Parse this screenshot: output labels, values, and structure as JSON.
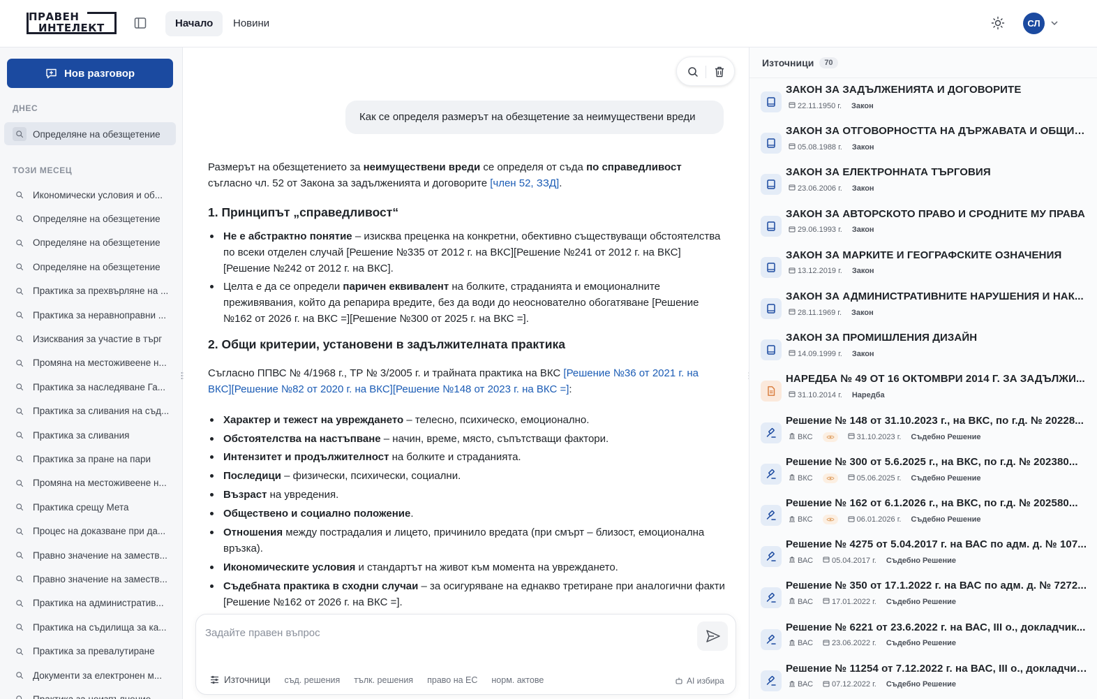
{
  "header": {
    "logo_line1": "ПРАВЕН",
    "logo_line2": "ИНТЕЛЕКТ",
    "tabs": [
      {
        "label": "Начало",
        "active": true
      },
      {
        "label": "Новини",
        "active": false
      }
    ],
    "avatar_initials": "СЛ"
  },
  "colors": {
    "accent": "#1b4aa0",
    "citation": "#1b5cb5"
  },
  "sidebar": {
    "new_chat_label": "Нов разговор",
    "section_today": "ДНЕС",
    "section_month": "ТОЗИ МЕСЕЦ",
    "today_items": [
      "Определяне на обезщетение"
    ],
    "month_items": [
      "Икономически условия и об...",
      "Определяне на обезщетение",
      "Определяне на обезщетение",
      "Определяне на обезщетение",
      "Практика за прехвърляне на ...",
      "Практика за неравноправни ...",
      "Изисквания за участие в търг",
      "Промяна на местоживеене н...",
      "Практика за наследяване Га...",
      "Практика за сливания на съд...",
      "Практика за сливания",
      "Практика за пране на пари",
      "Промяна на местоживеене н...",
      "Практика срещу Мета",
      "Процес на доказване при да...",
      "Правно значение на заместв...",
      "Правно значение на заместв...",
      "Практика на административ...",
      "Практика на съдилища за ка...",
      "Практика за превалутиране",
      "Документи за електронен м...",
      "Практика за неизпълнение..."
    ]
  },
  "chat": {
    "user_question": "Как се определя размерът на обезщетение за неимуществени вреди",
    "intro": {
      "p1": "Размерът на обезщетението за ",
      "b1": "неимуществени вреди",
      "p2": " се определя от съда ",
      "b2": "по справедливост",
      "p3": " съгласно чл. 52 от Закона за задълженията и договорите ",
      "cite": "[член 52, ЗЗД]",
      "p4": "."
    },
    "h1": "1. Принципът „справедливост“",
    "principles": [
      {
        "bold": "Не е абстрактно понятие",
        "text": " – изисква преценка на конкретни, обективно съществуващи обстоятелства по всеки отделен случай ",
        "cite": "[Решение №335 от 2012 г. на ВКС][Решение №241 от 2012 г. на ВКС][Решение №242 от 2012 г. на ВКС]",
        "end": "."
      },
      {
        "pre": "Целта е да се определи ",
        "bold": "паричен еквивалент",
        "text": " на болките, страданията и емоционалните преживявания, който да репарира вредите, без да води до неоснователно обогатяване ",
        "cite": "[Решение №162 от 2026 г. на ВКС =][Решение №300 от 2025 г. на ВКС =]",
        "end": "."
      }
    ],
    "h2": "2. Общи критерии, установени в задължителната практика",
    "criteria_intro": "Съгласно ППВС № 4/1968 г., ТР № 3/2005 г. и трайната практика на ВКС ",
    "criteria_cite": "[Решение №36 от 2021 г. на ВКС][Решение №82 от 2020 г. на ВКС][Решение №148 от 2023 г. на ВКС =]",
    "criteria_end": ":",
    "criteria": [
      {
        "bold": "Характер и тежест на увреждането",
        "text": " – телесно, психическо, емоционално."
      },
      {
        "bold": "Обстоятелства на настъпване",
        "text": " – начин, време, място, съпътстващи фактори."
      },
      {
        "bold": "Интензитет и продължителност",
        "text": " на болките и страданията."
      },
      {
        "bold": "Последици",
        "text": " – физически, психически, социални."
      },
      {
        "bold": "Възраст",
        "text": " на увредения."
      },
      {
        "bold": "Обществено и социално положение",
        "text": "."
      },
      {
        "bold": "Отношения",
        "text": " между пострадалия и лицето, причинило вредата (при смърт – близост, емоционална връзка)."
      },
      {
        "bold": "Икономическите условия",
        "text": " и стандартът на живот към момента на увреждането."
      },
      {
        "bold": "Съдебната практика в сходни случаи",
        "text": " – за осигуряване на еднакво третиране при аналогични факти ",
        "cite": "[Решение №162 от 2026 г. на ВКС =]",
        "end": "."
      }
    ]
  },
  "composer": {
    "placeholder": "Задайте правен въпрос",
    "sources_label": "Източници",
    "chips": [
      "съд. решения",
      "тълк. решения",
      "право на ЕС",
      "норм. актове"
    ],
    "ai_label": "AI избира"
  },
  "sources": {
    "title": "Източници",
    "count": "70",
    "items": [
      {
        "icon": "book-icon",
        "name": "ЗАКОН ЗА ЗАДЪЛЖЕНИЯТА И ДОГОВОРИТЕ",
        "date": "22.11.1950 г.",
        "kind": "Закон"
      },
      {
        "icon": "book-icon",
        "name": "ЗАКОН ЗА ОТГОВОРНОСТТА НА ДЪРЖАВАТА И ОБЩИН...",
        "date": "05.08.1988 г.",
        "kind": "Закон"
      },
      {
        "icon": "book-icon",
        "name": "ЗАКОН ЗА ЕЛЕКТРОННАТА ТЪРГОВИЯ",
        "date": "23.06.2006 г.",
        "kind": "Закон"
      },
      {
        "icon": "book-icon",
        "name": "ЗАКОН ЗА АВТОРСКОТО ПРАВО И СРОДНИТЕ МУ ПРАВА",
        "date": "29.06.1993 г.",
        "kind": "Закон"
      },
      {
        "icon": "book-icon",
        "name": "ЗАКОН ЗА МАРКИТЕ И ГЕОГРАФСКИТЕ ОЗНАЧЕНИЯ",
        "date": "13.12.2019 г.",
        "kind": "Закон"
      },
      {
        "icon": "book-icon",
        "name": "ЗАКОН ЗА АДМИНИСТРАТИВНИТЕ НАРУШЕНИЯ И НАК...",
        "date": "28.11.1969 г.",
        "kind": "Закон"
      },
      {
        "icon": "book-icon",
        "name": "ЗАКОН ЗА ПРОМИШЛЕНИЯ ДИЗАЙН",
        "date": "14.09.1999 г.",
        "kind": "Закон"
      },
      {
        "icon": "document-icon",
        "name": "НАРЕДБА № 49 ОТ 16 ОКТОМВРИ 2014 Г. ЗА ЗАДЪЛЖИ...",
        "date": "31.10.2014 г.",
        "kind": "Наредба"
      },
      {
        "icon": "gavel-icon",
        "name": "Решение № 148 от 31.10.2023 г., на ВКС, по г.д. № 20228...",
        "court": "ВКС",
        "eye": true,
        "date": "31.10.2023 г.",
        "kind": "Съдебно Решение"
      },
      {
        "icon": "gavel-icon",
        "name": "Решение № 300 от 5.6.2025 г., на ВКС, по г.д. № 202380...",
        "court": "ВКС",
        "eye": true,
        "date": "05.06.2025 г.",
        "kind": "Съдебно Решение"
      },
      {
        "icon": "gavel-icon",
        "name": "Решение № 162 от 6.1.2026 г., на ВКС, по г.д. № 202580...",
        "court": "ВКС",
        "eye": true,
        "date": "06.01.2026 г.",
        "kind": "Съдебно Решение"
      },
      {
        "icon": "gavel-icon",
        "name": "Решение № 4275 от 5.04.2017 г. на ВАС по адм. д. № 107...",
        "court": "ВАС",
        "eye": false,
        "date": "05.04.2017 г.",
        "kind": "Съдебно Решение"
      },
      {
        "icon": "gavel-icon",
        "name": "Решение № 350 от 17.1.2022 г. на ВАС по адм. д. № 7272...",
        "court": "ВАС",
        "eye": false,
        "date": "17.01.2022 г.",
        "kind": "Съдебно Решение"
      },
      {
        "icon": "gavel-icon",
        "name": "Решение № 6221 от 23.6.2022 г. на ВАС, III о., докладчик...",
        "court": "ВАС",
        "eye": false,
        "date": "23.06.2022 г.",
        "kind": "Съдебно Решение"
      },
      {
        "icon": "gavel-icon",
        "name": "Решение № 11254 от 7.12.2022 г. на ВАС, III о., докладчик...",
        "court": "ВАС",
        "eye": false,
        "date": "07.12.2022 г.",
        "kind": "Съдебно Решение"
      }
    ]
  }
}
